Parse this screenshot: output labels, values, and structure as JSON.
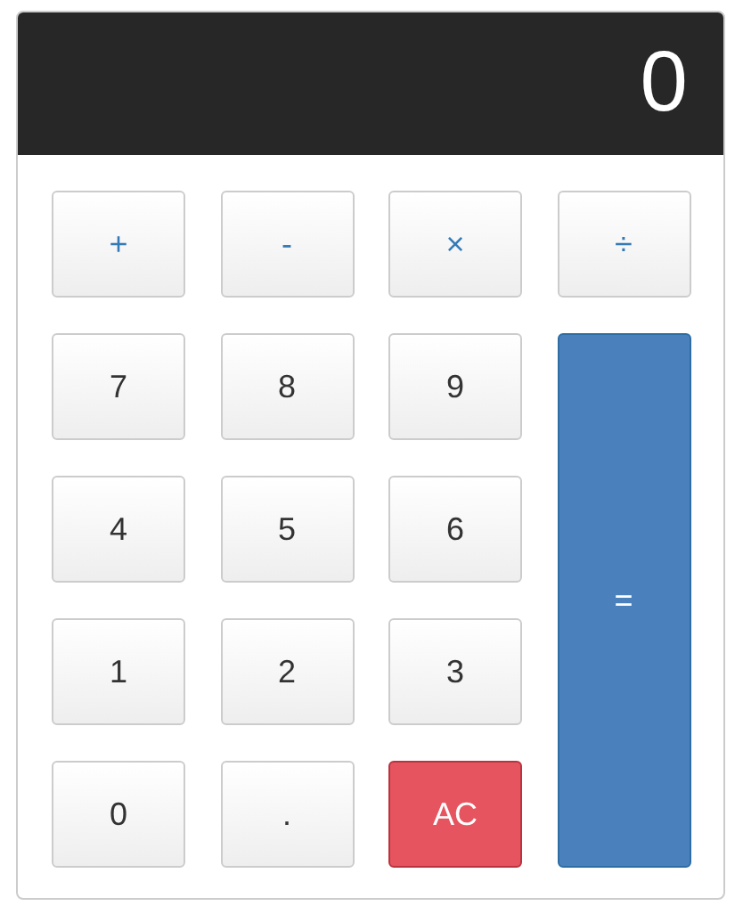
{
  "display": "0",
  "buttons": [
    {
      "label": "+",
      "kind": "operator"
    },
    {
      "label": "-",
      "kind": "operator"
    },
    {
      "label": "×",
      "kind": "operator"
    },
    {
      "label": "÷",
      "kind": "operator"
    },
    {
      "label": "7",
      "kind": "digit"
    },
    {
      "label": "8",
      "kind": "digit"
    },
    {
      "label": "9",
      "kind": "digit"
    },
    {
      "label": "=",
      "kind": "equals"
    },
    {
      "label": "4",
      "kind": "digit"
    },
    {
      "label": "5",
      "kind": "digit"
    },
    {
      "label": "6",
      "kind": "digit"
    },
    {
      "label": "1",
      "kind": "digit"
    },
    {
      "label": "2",
      "kind": "digit"
    },
    {
      "label": "3",
      "kind": "digit"
    },
    {
      "label": "0",
      "kind": "digit"
    },
    {
      "label": ".",
      "kind": "digit"
    },
    {
      "label": "AC",
      "kind": "clear"
    }
  ]
}
